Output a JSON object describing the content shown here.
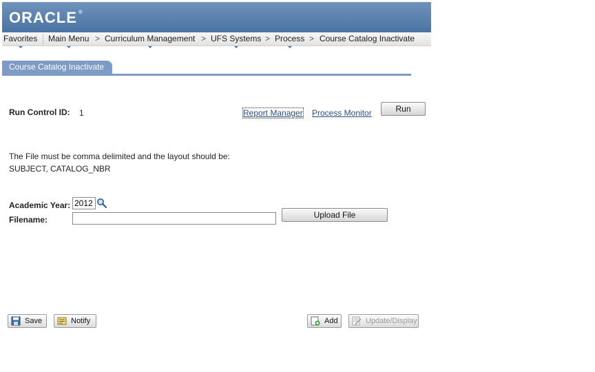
{
  "header": {
    "logo": "ORACLE",
    "logo_mark": "®"
  },
  "nav": {
    "items": [
      {
        "label": "Favorites"
      },
      {
        "label": "Main Menu"
      },
      {
        "label": "Curriculum Management"
      },
      {
        "label": "UFS Systems"
      },
      {
        "label": "Process"
      },
      {
        "label": "Course Catalog Inactivate"
      }
    ],
    "separator": ">"
  },
  "tab": {
    "label": "Course Catalog Inactivate"
  },
  "run_control": {
    "label": "Run Control ID:",
    "value": "1"
  },
  "links": {
    "report_manager": "Report Manager",
    "process_monitor": "Process Monitor"
  },
  "run_button": "Run",
  "instructions": {
    "line1": "The File must be comma delimited and the layout should be:",
    "line2": "SUBJECT, CATALOG_NBR"
  },
  "form": {
    "academic_year_label": "Academic Year:",
    "academic_year_value": "2012",
    "filename_label": "Filename:",
    "filename_value": "",
    "upload_button": "Upload File"
  },
  "toolbar": {
    "save": "Save",
    "notify": "Notify",
    "add": "Add",
    "update_display": "Update/Display"
  },
  "colors": {
    "header": "#4a74a3",
    "tab": "#7d9bc4",
    "link": "#2a4f7e"
  }
}
